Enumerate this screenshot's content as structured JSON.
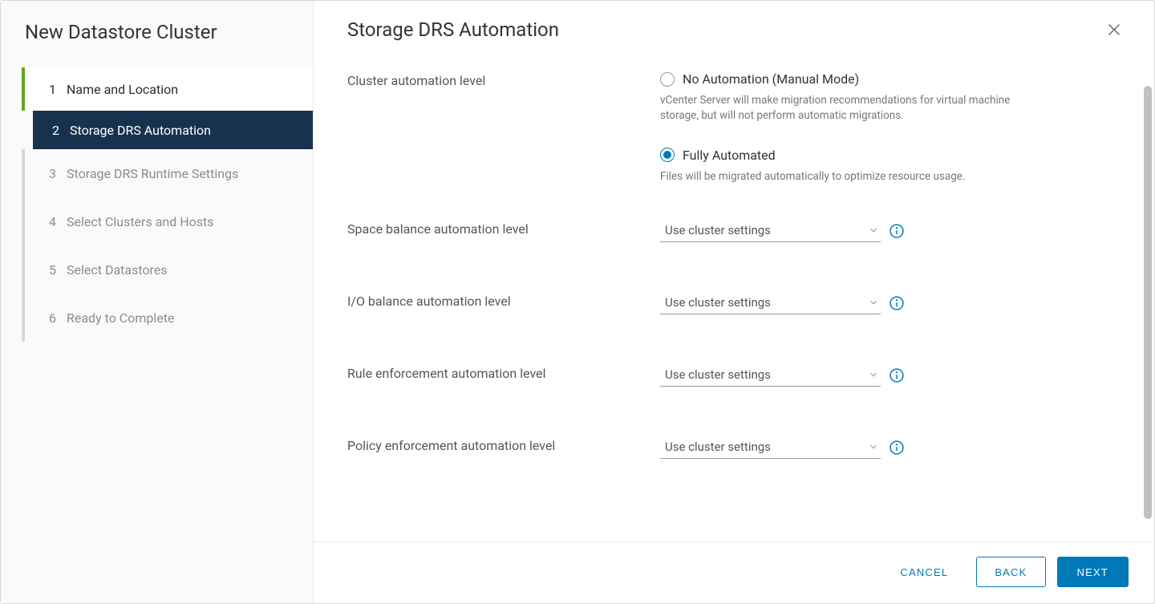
{
  "sidebar": {
    "title": "New Datastore Cluster",
    "steps": [
      {
        "num": "1",
        "label": "Name and Location",
        "state": "completed"
      },
      {
        "num": "2",
        "label": "Storage DRS Automation",
        "state": "active"
      },
      {
        "num": "3",
        "label": "Storage DRS Runtime Settings",
        "state": "upcoming"
      },
      {
        "num": "4",
        "label": "Select Clusters and Hosts",
        "state": "upcoming"
      },
      {
        "num": "5",
        "label": "Select Datastores",
        "state": "upcoming"
      },
      {
        "num": "6",
        "label": "Ready to Complete",
        "state": "upcoming"
      }
    ]
  },
  "content": {
    "title": "Storage DRS Automation",
    "cluster_automation": {
      "label": "Cluster automation level",
      "options": [
        {
          "label": "No Automation (Manual Mode)",
          "help": "vCenter Server will make migration recommendations for virtual machine storage, but will not perform automatic migrations.",
          "selected": false
        },
        {
          "label": "Fully Automated",
          "help": "Files will be migrated automatically to optimize resource usage.",
          "selected": true
        }
      ]
    },
    "levels": [
      {
        "label": "Space balance automation level",
        "value": "Use cluster settings"
      },
      {
        "label": "I/O balance automation level",
        "value": "Use cluster settings"
      },
      {
        "label": "Rule enforcement automation level",
        "value": "Use cluster settings"
      },
      {
        "label": "Policy enforcement automation level",
        "value": "Use cluster settings"
      }
    ]
  },
  "footer": {
    "cancel": "CANCEL",
    "back": "BACK",
    "next": "NEXT"
  }
}
